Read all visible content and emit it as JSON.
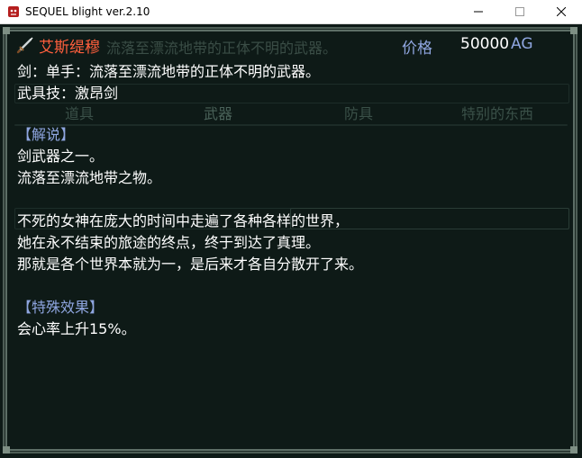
{
  "window": {
    "title": "SEQUEL blight ver.2.10"
  },
  "item": {
    "name": "艾斯缇穆",
    "ghost_header": "流落至漂流地带的正体不明的武器。",
    "price_label": "价格",
    "price_value": "50000",
    "price_unit": "AG",
    "line_weapon": "剑：单手：流落至漂流地带的正体不明的武器。",
    "line_skill": "武具技：激昂剑"
  },
  "sections": {
    "explain_title": "【解说】",
    "explain_lines": [
      "剑武器之一。",
      "流落至漂流地带之物。",
      "",
      "不死的女神在庞大的时间中走遍了各种各样的世界，",
      "她在永不结束的旅途的终点，终于到达了真理。",
      "那就是各个世界本就为一，是后来才各自分散开了来。"
    ],
    "effect_title": "【特殊效果】",
    "effect_lines": [
      "会心率上升15%。"
    ]
  },
  "background_tabs": [
    "道具",
    "武器",
    "防具",
    "特别的东西"
  ],
  "colors": {
    "name_red": "#ff5f3d",
    "label_blue": "#8fa6e0",
    "text_white": "#ffffff",
    "bg_dark": "#0e1a17"
  },
  "icons": {
    "app": "demon-face-icon",
    "item": "sword-icon",
    "minimize": "minimize-icon",
    "maximize": "maximize-icon",
    "close": "close-icon"
  }
}
